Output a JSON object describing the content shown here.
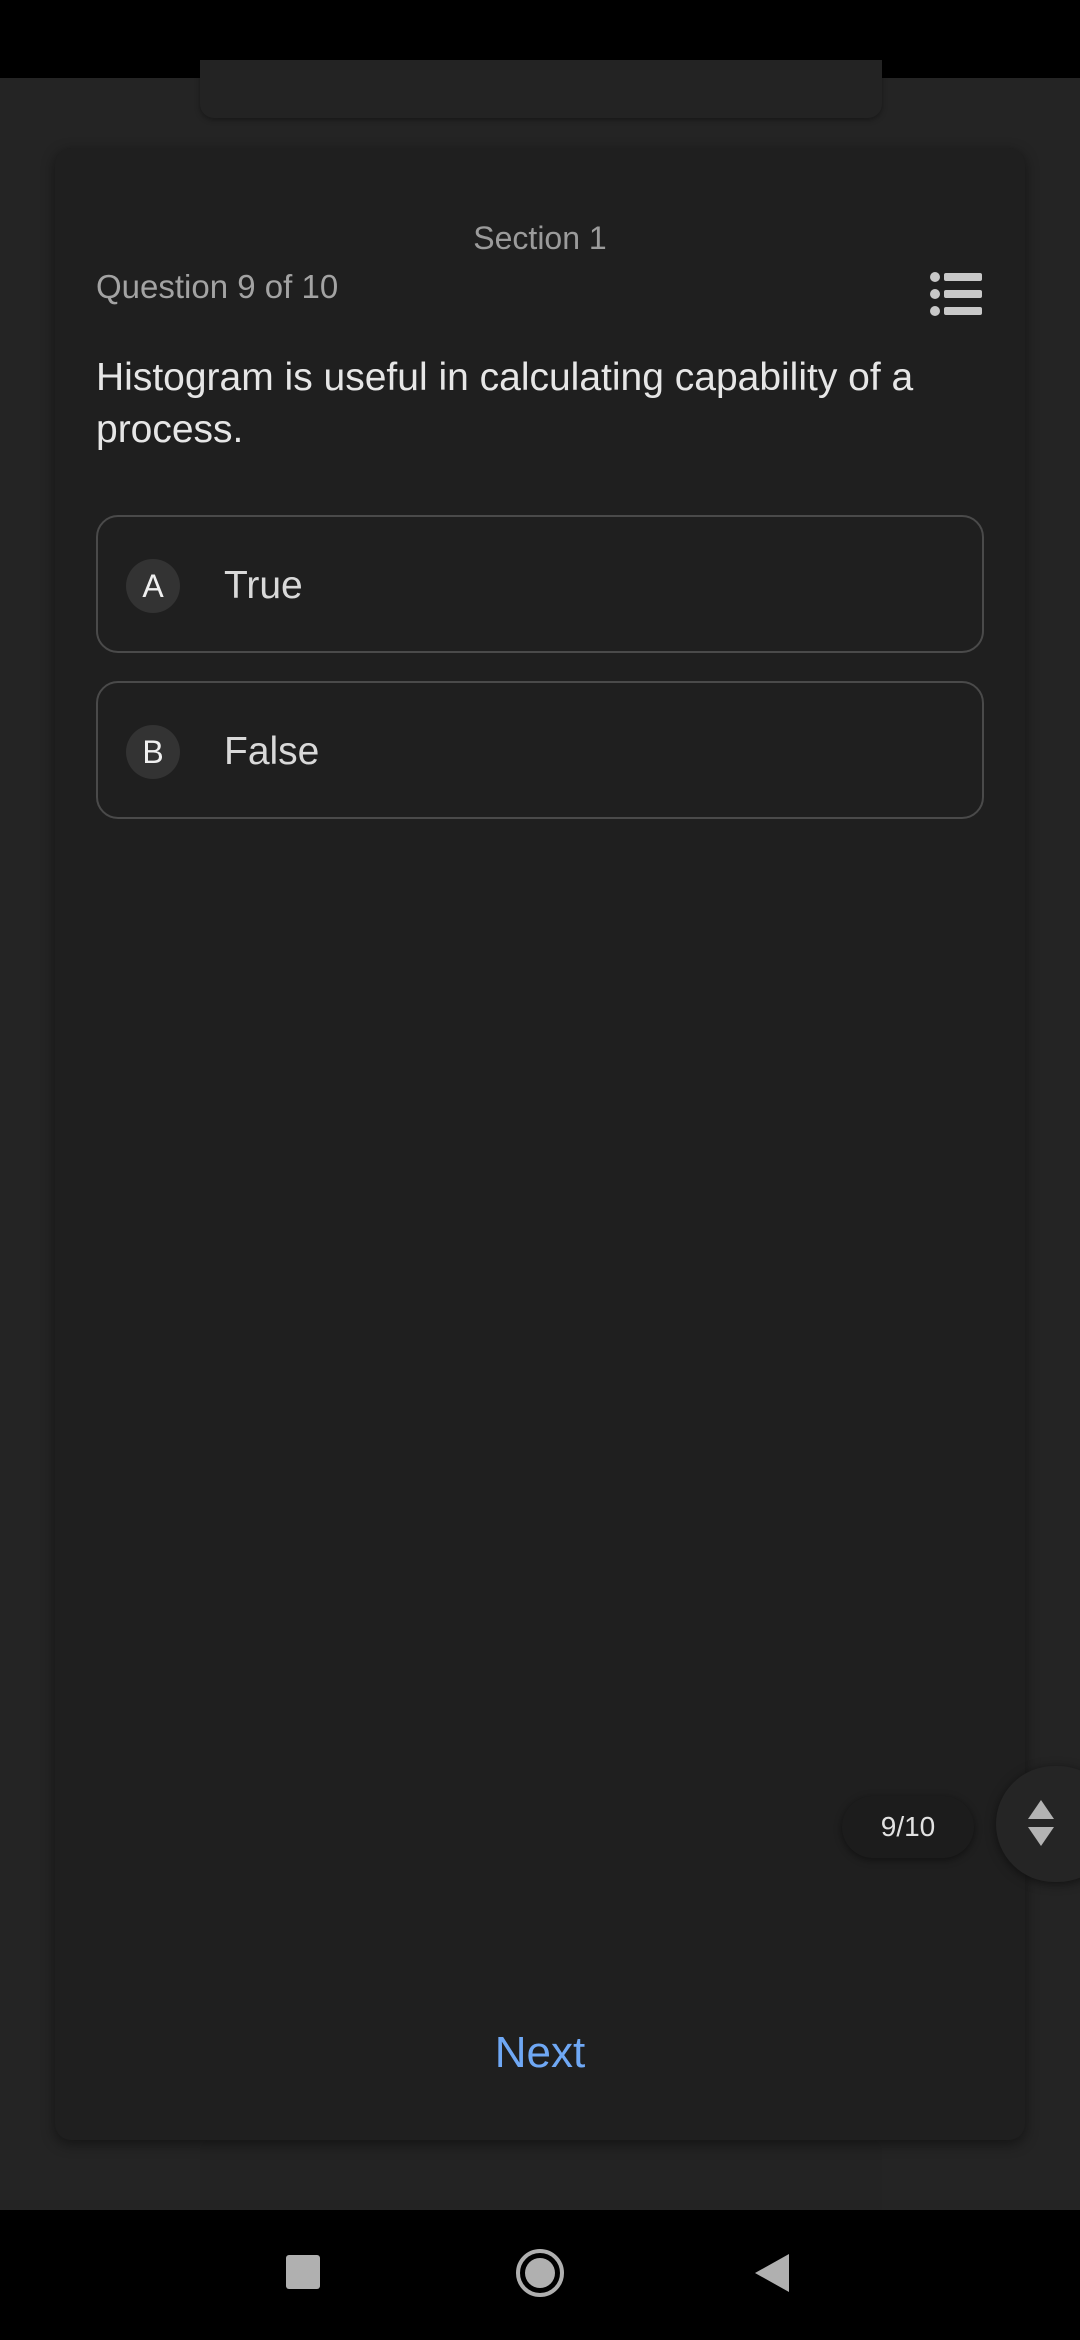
{
  "header": {
    "section_title": "Section 1",
    "question_counter": "Question 9 of 10"
  },
  "question": {
    "text": "Histogram is useful in calculating capability of a process."
  },
  "options": [
    {
      "letter": "A",
      "label": "True"
    },
    {
      "letter": "B",
      "label": "False"
    }
  ],
  "pagination": {
    "indicator": "9/10"
  },
  "footer": {
    "next_label": "Next"
  },
  "icons": {
    "question_list": "list-icon",
    "scroll": "up-down-arrows-icon",
    "nav_recents": "square-icon",
    "nav_home": "circle-icon",
    "nav_back": "triangle-back-icon"
  },
  "colors": {
    "background": "#242424",
    "card": "#1f1f1f",
    "accent": "#6fa8f5",
    "text_primary": "#e6e6e6",
    "text_secondary": "#a3a3a3"
  }
}
